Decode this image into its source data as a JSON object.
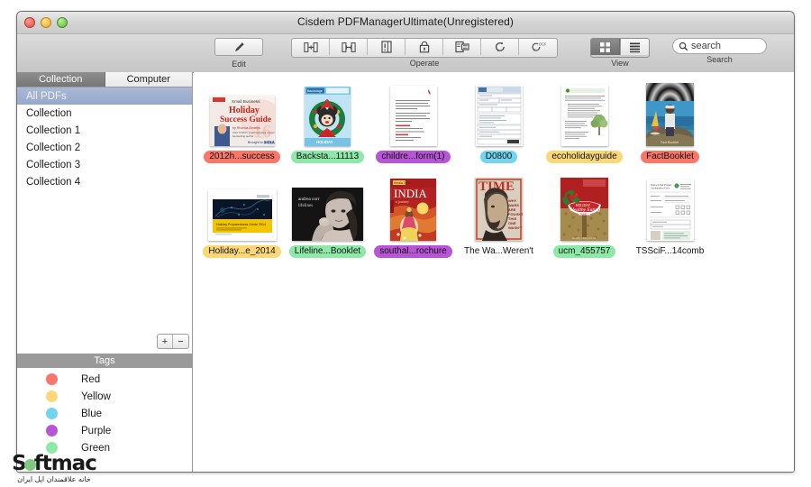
{
  "window": {
    "title": "Cisdem PDFManagerUltimate(Unregistered)",
    "traffic_lights": [
      "close",
      "minimize",
      "zoom"
    ]
  },
  "toolbar": {
    "groups": [
      {
        "name": "edit",
        "label": "Edit",
        "items": [
          {
            "icon": "pencil-icon",
            "name": "edit-button"
          }
        ]
      },
      {
        "name": "operate",
        "label": "Operate",
        "items": [
          {
            "icon": "merge-icon",
            "name": "merge-button"
          },
          {
            "icon": "split-icon",
            "name": "split-button"
          },
          {
            "icon": "document-info-icon",
            "name": "document-info-button"
          },
          {
            "icon": "lock-icon",
            "name": "encrypt-button"
          },
          {
            "icon": "extract-image-icon",
            "name": "extract-image-button"
          },
          {
            "icon": "convert-icon",
            "name": "convert-button"
          },
          {
            "icon": "ocr-icon",
            "name": "ocr-button"
          }
        ]
      },
      {
        "name": "view",
        "label": "View",
        "items": [
          {
            "icon": "grid-view-icon",
            "name": "grid-view-button",
            "active": true
          },
          {
            "icon": "list-view-icon",
            "name": "list-view-button",
            "active": false
          }
        ]
      },
      {
        "name": "search",
        "label": "Search",
        "placeholder": "search",
        "value": ""
      }
    ],
    "edit_label": "Edit",
    "operate_label": "Operate",
    "view_label": "View",
    "search_label": "Search",
    "search_placeholder": "search"
  },
  "sidebar": {
    "tabs": [
      {
        "label": "Collection",
        "active": true
      },
      {
        "label": "Computer",
        "active": false
      }
    ],
    "collections": [
      {
        "label": "All PDFs",
        "selected": true
      },
      {
        "label": "Collection",
        "selected": false
      },
      {
        "label": "Collection 1",
        "selected": false
      },
      {
        "label": "Collection 2",
        "selected": false
      },
      {
        "label": "Collection 3",
        "selected": false
      },
      {
        "label": "Collection 4",
        "selected": false
      }
    ],
    "add_label": "+",
    "remove_label": "−",
    "tags_header": "Tags",
    "tags": [
      {
        "label": "Red",
        "color": "#f8776b"
      },
      {
        "label": "Yellow",
        "color": "#fad87a"
      },
      {
        "label": "Blue",
        "color": "#72d4ed"
      },
      {
        "label": "Purple",
        "color": "#b855d6"
      },
      {
        "label": "Green",
        "color": "#8ee8a8"
      }
    ]
  },
  "main": {
    "files": [
      {
        "caption": "2012h...success",
        "tag_color": "#f8776b",
        "thumb": "holiday-success-guide"
      },
      {
        "caption": "Backsta...11113",
        "tag_color": "#8ee8a8",
        "thumb": "minnie-holiday"
      },
      {
        "caption": "childre...form(1)",
        "tag_color": "#b855d6",
        "thumb": "text-form-red"
      },
      {
        "caption": "D0800",
        "tag_color": "#72d4ed",
        "thumb": "dense-form"
      },
      {
        "caption": "ecoholidayguide",
        "tag_color": "#fad87a",
        "thumb": "eco-tree-doc"
      },
      {
        "caption": "FactBooklet",
        "tag_color": "#f8776b",
        "thumb": "fact-booklet-cover"
      },
      {
        "caption": "Holiday...e_2014",
        "tag_color": "#fad87a",
        "thumb": "holiday-slide-2014"
      },
      {
        "caption": "Lifeline...Booklet",
        "tag_color": "#8ee8a8",
        "thumb": "andrea-corr-bw"
      },
      {
        "caption": "southal...rochure",
        "tag_color": "#b855d6",
        "thumb": "india-brochure"
      },
      {
        "caption": "The Wa...Weren't",
        "tag_color": "transparent",
        "thumb": "time-lincoln"
      },
      {
        "caption": "ucm_455757",
        "tag_color": "#8ee8a8",
        "thumb": "healthy-eating"
      },
      {
        "caption": "TSSciF...14comb",
        "tag_color": "transparent",
        "thumb": "green-form"
      }
    ]
  },
  "watermark": {
    "brand": "S ftmac",
    "brand_prefix": "S",
    "brand_suffix": "ftmac",
    "subtitle": "خانه علاقمندان اپل ایران"
  }
}
